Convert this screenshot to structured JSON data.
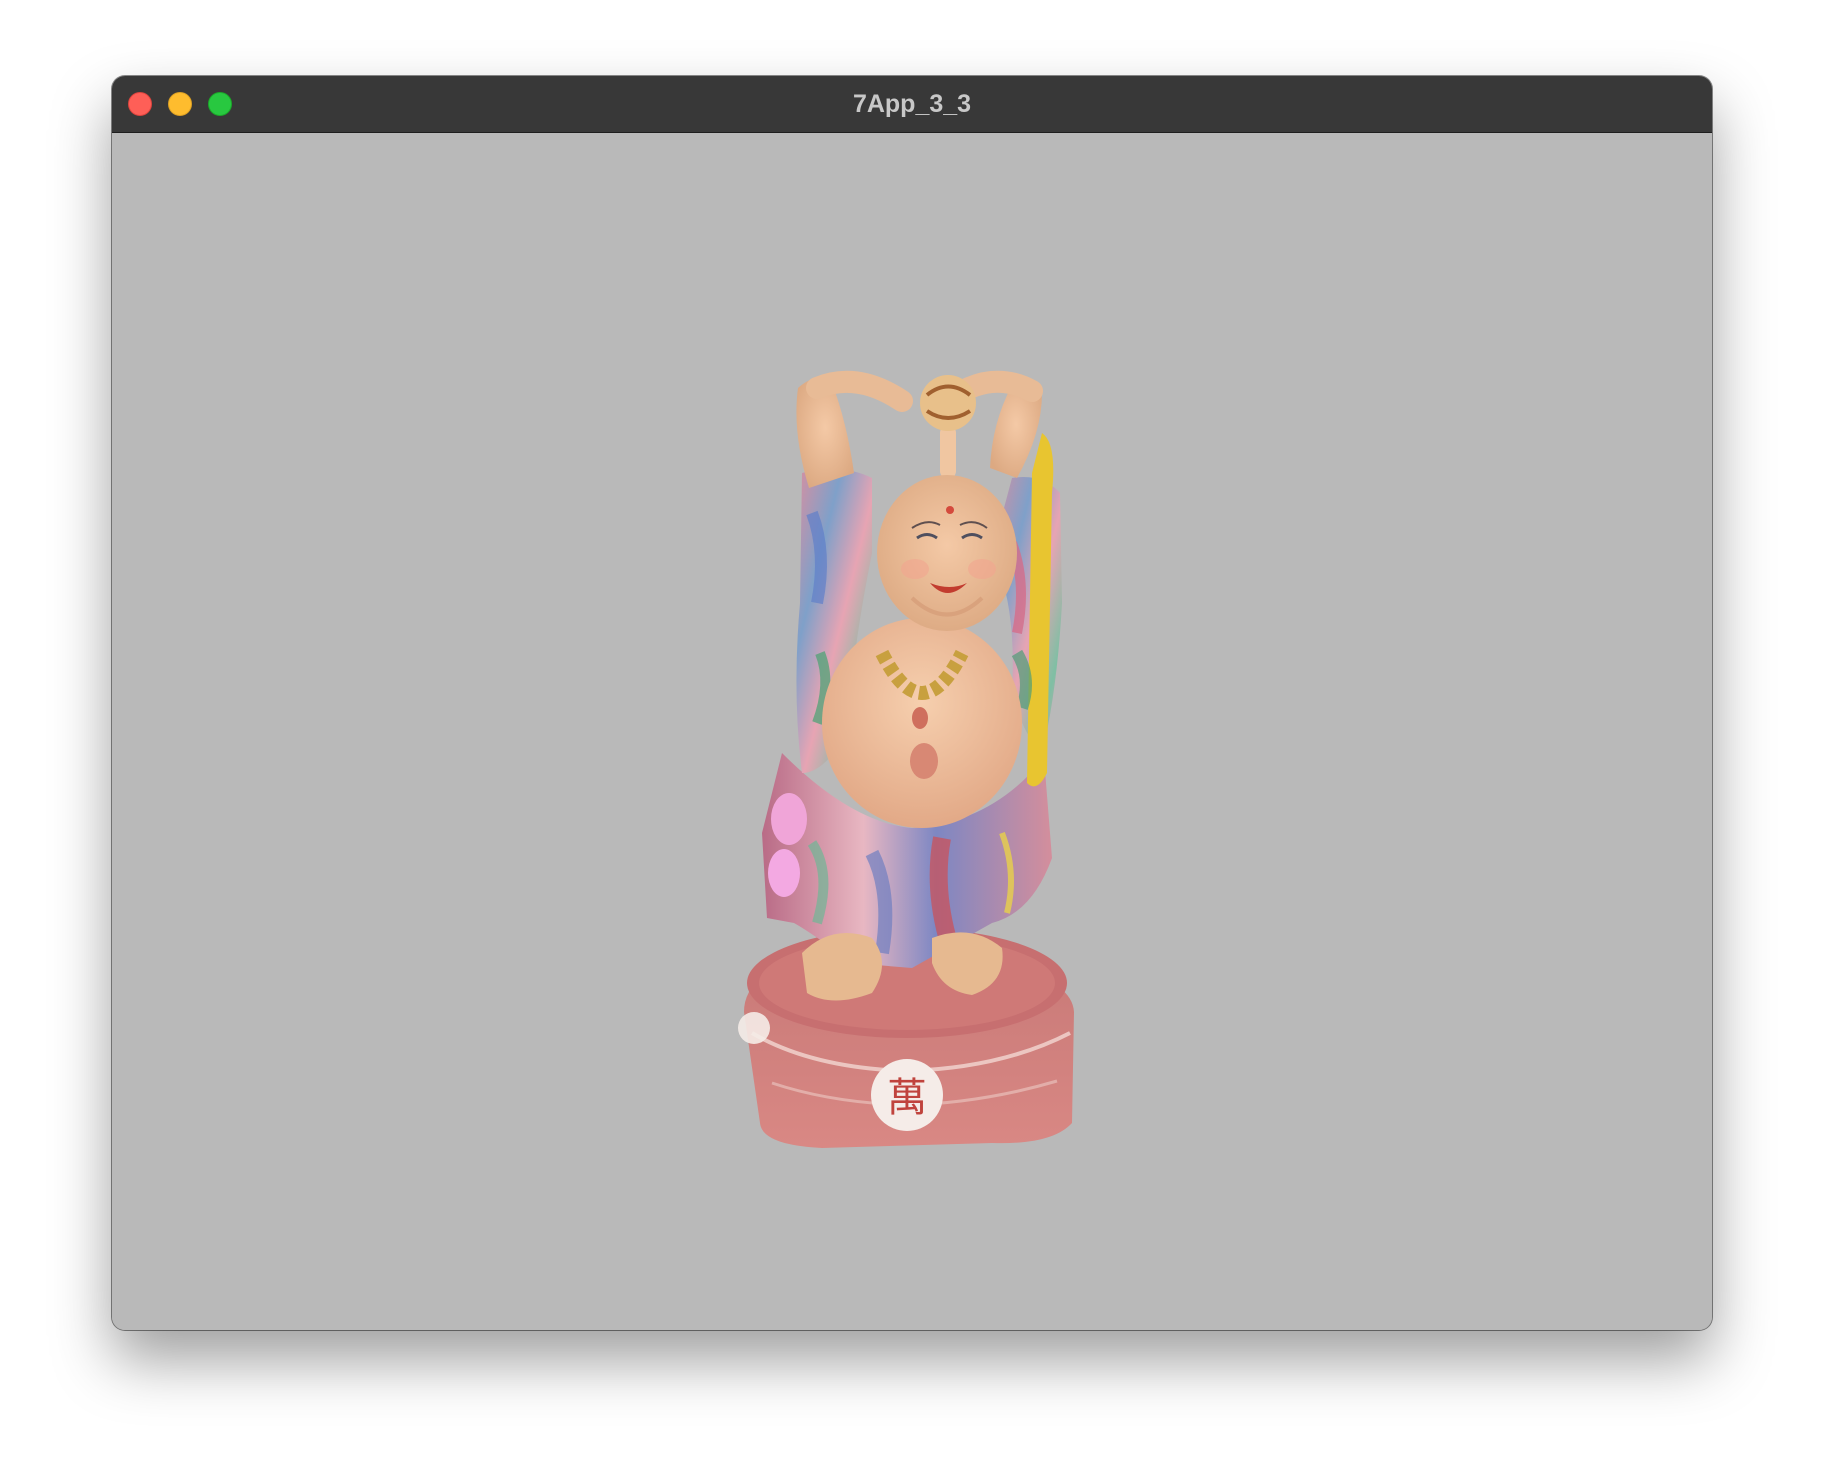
{
  "window": {
    "title": "7App_3_3"
  },
  "viewport": {
    "background_color": "#b9b9b9",
    "model_icon": "laughing-buddha-3d-model"
  },
  "colors": {
    "titlebar": "#383838",
    "close": "#fe5f57",
    "minimize": "#febc2e",
    "zoom": "#28c840"
  }
}
